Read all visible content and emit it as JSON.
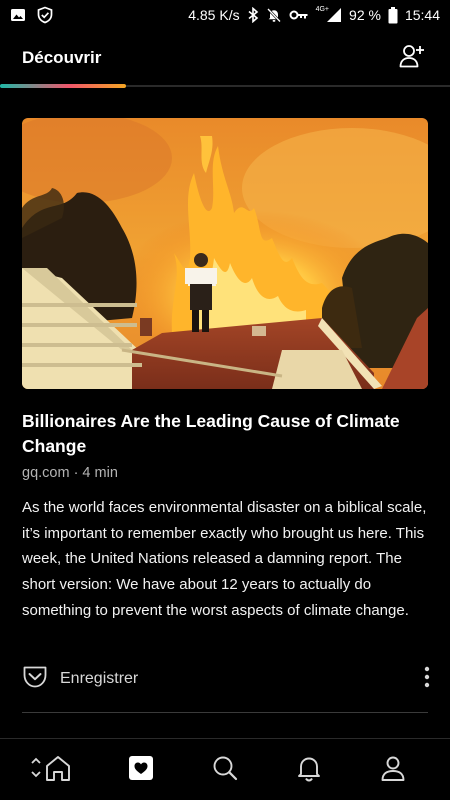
{
  "status_bar": {
    "network_speed": "4.85 K/s",
    "network_type": "4G+",
    "battery": "92 %",
    "time": "15:44",
    "icons": [
      "image-icon",
      "shield-check-icon",
      "bluetooth-icon",
      "mute-icon",
      "vpn-key-icon",
      "signal-icon",
      "battery-icon"
    ]
  },
  "header": {
    "title": "Découvrir",
    "add_user_icon": "add-user-icon",
    "tab_indicator_colors": [
      "#1fb7a6",
      "#f0566b",
      "#f5a623"
    ]
  },
  "article": {
    "title": "Billionaires Are the Leading Cause of Climate Change",
    "meta": "gq.com · 4 min",
    "excerpt": "As the world faces environmental disaster on a biblical scale, it’s important to remember exactly who brought us here.  This week, the United Nations released a damning report. The short version: We have about 12 years to actually do something to prevent the worst aspects of climate change.",
    "save_label": "Enregistrer",
    "save_icon": "pocket-icon",
    "more_icon": "more-vertical-icon"
  },
  "bottom_nav": {
    "items": [
      "home-icon",
      "saves-icon",
      "search-icon",
      "notifications-icon",
      "profile-icon"
    ],
    "active": "saves-icon"
  }
}
